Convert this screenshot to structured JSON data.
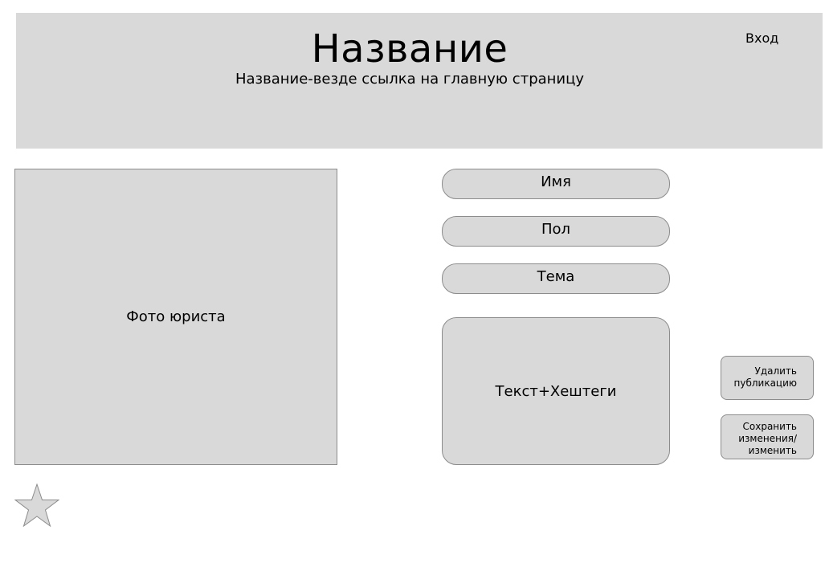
{
  "header": {
    "title": "Название",
    "subtitle": "Название-везде ссылка на главную страницу",
    "login_label": "Вход"
  },
  "profile": {
    "photo_label": "Фото юриста",
    "name_label": "Имя",
    "gender_label": "Пол",
    "topic_label": "Тема",
    "text_label": "Текст+Хештеги"
  },
  "actions": {
    "delete_label": "Удалить\nпубликацию",
    "save_label": "Сохранить\nизменения/\nизменить"
  },
  "icons": {
    "favorite": "star-icon"
  },
  "colors": {
    "panel": "#d9d9d9",
    "border": "#8c8c8c"
  }
}
